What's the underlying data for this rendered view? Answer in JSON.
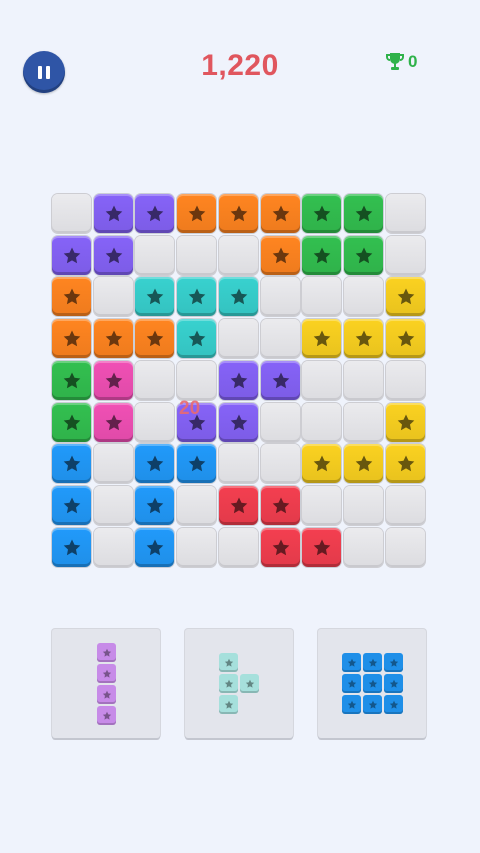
{
  "header": {
    "score": "1,220",
    "best_score": "0"
  },
  "popup_points": "20",
  "colors": {
    "purple": "#7c5ce6",
    "orange": "#ee7b1e",
    "green": "#2fb24a",
    "teal": "#34c2c0",
    "yellow": "#e8c21e",
    "magenta": "#df4aa8",
    "blue": "#1f8fe8",
    "red": "#e23a4a"
  },
  "board": [
    [
      ".",
      "P",
      "P",
      "O",
      "O",
      "O",
      "G",
      "G",
      "."
    ],
    [
      "P",
      "P",
      ".",
      ".",
      ".",
      "O",
      "G",
      "G",
      "."
    ],
    [
      "O",
      ".",
      "T",
      "T",
      "T",
      ".",
      ".",
      ".",
      "Y"
    ],
    [
      "O",
      "O",
      "O",
      "T",
      ".",
      ".",
      "Y",
      "Y",
      "Y"
    ],
    [
      "G",
      "M",
      ".",
      ".",
      "P",
      "P",
      ".",
      ".",
      "."
    ],
    [
      "G",
      "M",
      ".",
      "P",
      "P",
      ".",
      ".",
      ".",
      "Y"
    ],
    [
      "B",
      ".",
      "B",
      "B",
      ".",
      ".",
      "Y",
      "Y",
      "Y"
    ],
    [
      "B",
      ".",
      "B",
      ".",
      "R",
      "R",
      ".",
      ".",
      "."
    ],
    [
      "B",
      ".",
      "B",
      ".",
      ".",
      "R",
      "R",
      ".",
      "."
    ]
  ],
  "pieces": [
    {
      "color": "#c78be8",
      "cells": [
        [
          0,
          0
        ],
        [
          1,
          0
        ],
        [
          2,
          0
        ],
        [
          3,
          0
        ]
      ]
    },
    {
      "color": "#a6e0dc",
      "cells": [
        [
          0,
          0
        ],
        [
          1,
          0
        ],
        [
          1,
          1
        ],
        [
          2,
          0
        ]
      ]
    },
    {
      "color": "#1f8fe8",
      "cells": [
        [
          0,
          0
        ],
        [
          0,
          1
        ],
        [
          0,
          2
        ],
        [
          1,
          0
        ],
        [
          1,
          1
        ],
        [
          1,
          2
        ],
        [
          2,
          0
        ],
        [
          2,
          1
        ],
        [
          2,
          2
        ]
      ]
    }
  ]
}
